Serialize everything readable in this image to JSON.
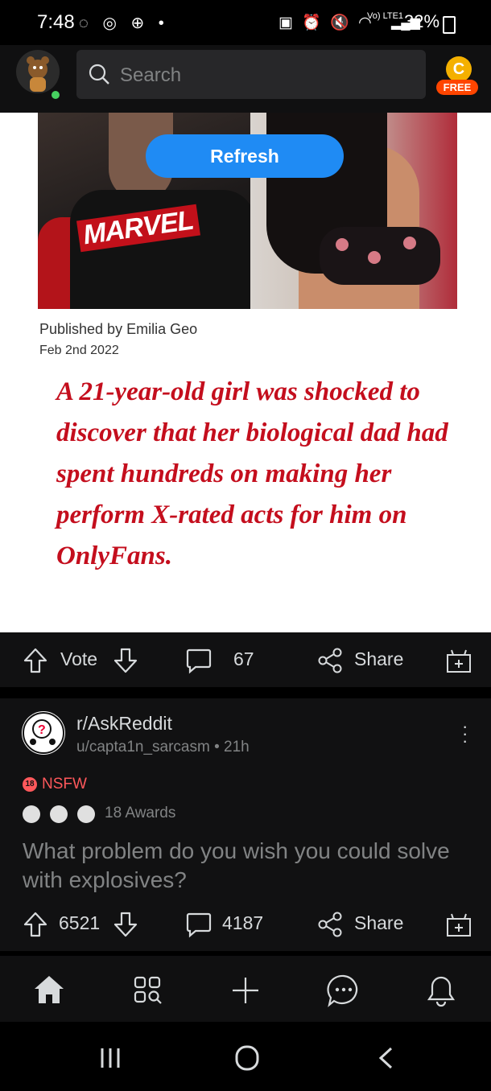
{
  "status_bar": {
    "time": "7:48",
    "battery": "32%",
    "network": "Vo) LTE1"
  },
  "header": {
    "search_placeholder": "Search",
    "coin_letter": "C",
    "free_badge": "FREE"
  },
  "post1": {
    "refresh_label": "Refresh",
    "image_text": {
      "shirt_brand": "MARVEL",
      "published_by": "Published by Emilia Geo",
      "date": "Feb 2nd 2022",
      "headline": "A 21-year-old girl was shocked to discover that her biological dad had spent hundreds on making her perform X-rated acts for him on OnlyFans."
    },
    "actions": {
      "vote_label": "Vote",
      "comments": "67",
      "share_label": "Share"
    }
  },
  "post2": {
    "subreddit": "r/AskReddit",
    "byline": "u/capta1n_sarcasm • 21h",
    "nsfw_label": "NSFW",
    "nsfw_badge": "18",
    "awards": "18 Awards",
    "title": "What problem do you wish you could solve with explosives?",
    "actions": {
      "votes": "6521",
      "comments": "4187",
      "share_label": "Share"
    }
  },
  "colors": {
    "accent": "#ff4500",
    "refresh_blue": "#1f8bf4",
    "headline_red": "#c40e1d",
    "online_green": "#46d160"
  },
  "icons": [
    "search-icon",
    "upvote-icon",
    "downvote-icon",
    "comment-icon",
    "share-icon",
    "gift-icon",
    "home-icon",
    "discover-icon",
    "create-icon",
    "chat-icon",
    "bell-icon",
    "recents-icon",
    "home-circle-icon",
    "back-icon"
  ]
}
